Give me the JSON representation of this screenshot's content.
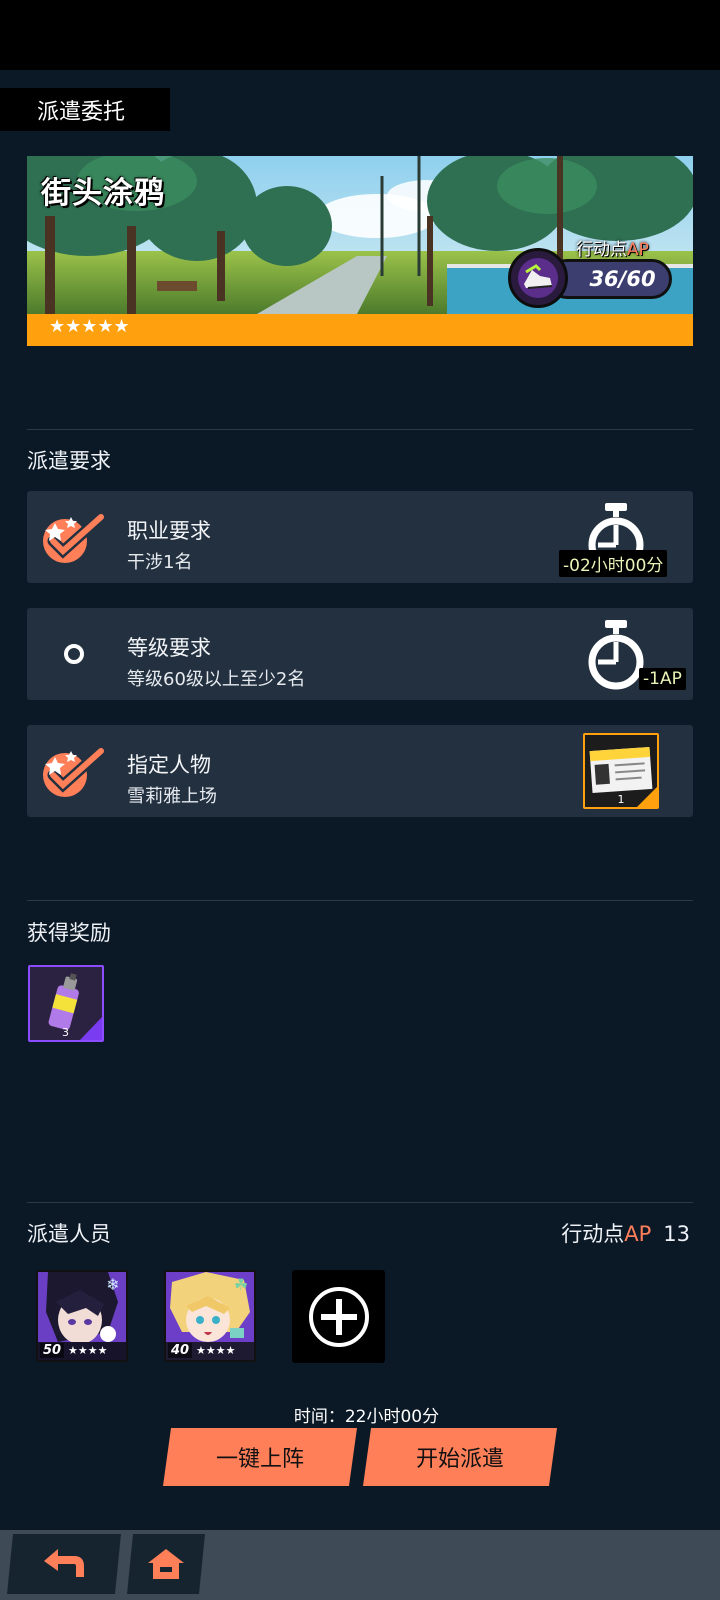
{
  "page": {
    "title": "派遣委托"
  },
  "banner": {
    "title": "街头涂鸦",
    "ap_label_prefix": "行动点",
    "ap_label_accent": "AP",
    "ap_value": "36/60",
    "stars": "★★★★★",
    "rarity_color": "#ffa10e"
  },
  "requirements": {
    "section_label": "派遣要求",
    "items": [
      {
        "title": "职业要求",
        "subtitle": "干涉1名",
        "status": "met",
        "reward_badge": "-02小时00分"
      },
      {
        "title": "等级要求",
        "subtitle": "等级60级以上至少2名",
        "status": "unmet",
        "reward_badge": "-1AP"
      },
      {
        "title": "指定人物",
        "subtitle": "雪莉雅上场",
        "status": "met",
        "reward_item_count": "1"
      }
    ]
  },
  "rewards": {
    "section_label": "获得奖励",
    "items": [
      {
        "icon": "spray-can-icon",
        "count": "3"
      }
    ]
  },
  "dispatch": {
    "section_label": "派遣人员",
    "ap_label_prefix": "行动点",
    "ap_label_accent": "AP",
    "ap_value": "13",
    "members": [
      {
        "level": "50",
        "stars": "★★★★",
        "element": "snowflake-icon"
      },
      {
        "level": "40",
        "stars": "★★★★",
        "element": "leaf-icon"
      }
    ],
    "time_text": "时间：22小时00分",
    "auto_button": "一键上阵",
    "start_button": "开始派遣"
  },
  "colors": {
    "accent": "#ff7f59",
    "background": "#0b1826",
    "card": "#22303f",
    "ap_accent": "#ff7e5a"
  }
}
